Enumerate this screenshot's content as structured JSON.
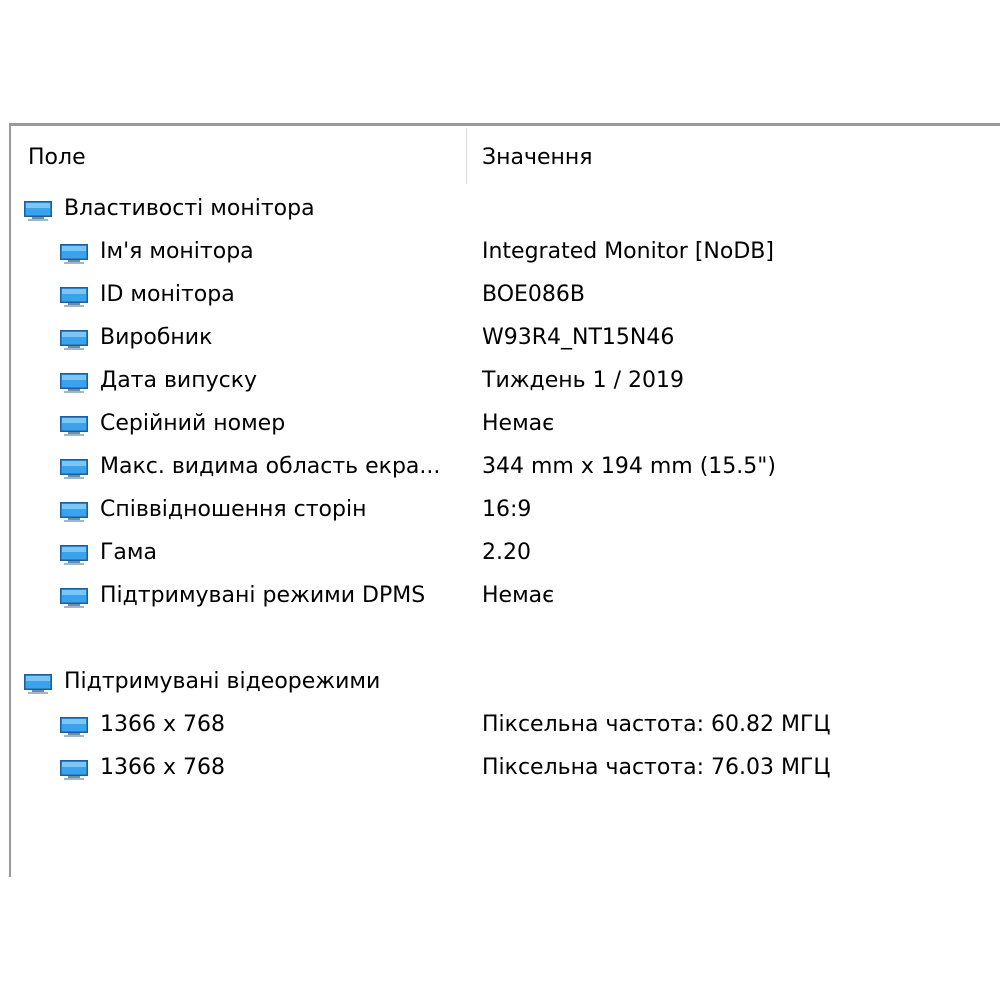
{
  "table": {
    "col_field": "Поле",
    "col_value": "Значення"
  },
  "groups": [
    {
      "title": "Властивості монітора",
      "icon": "monitor-icon",
      "rows": [
        {
          "field": "Ім'я монітора",
          "value": "Integrated Monitor [NoDB]"
        },
        {
          "field": "ID монітора",
          "value": "BOE086B"
        },
        {
          "field": "Виробник",
          "value": "W93R4_NT15N46"
        },
        {
          "field": "Дата випуску",
          "value": "Тиждень 1 / 2019"
        },
        {
          "field": "Серійний номер",
          "value": "Немає"
        },
        {
          "field": "Макс. видима область екра...",
          "value": "344 mm x 194 mm (15.5\")"
        },
        {
          "field": "Співвідношення сторін",
          "value": "16:9"
        },
        {
          "field": "Гама",
          "value": "2.20"
        },
        {
          "field": "Підтримувані режими DPMS",
          "value": "Немає"
        }
      ]
    },
    {
      "title": "Підтримувані відеорежими",
      "icon": "monitor-icon",
      "rows": [
        {
          "field": "1366 x 768",
          "value": "Піксельна частота: 60.82 МГЦ"
        },
        {
          "field": "1366 x 768",
          "value": "Піксельна частота: 76.03 МГЦ"
        }
      ]
    }
  ],
  "colors": {
    "border": "#9a9a9a",
    "monitor_screen": "#2f96e0",
    "monitor_frame": "#1b5f9e"
  }
}
